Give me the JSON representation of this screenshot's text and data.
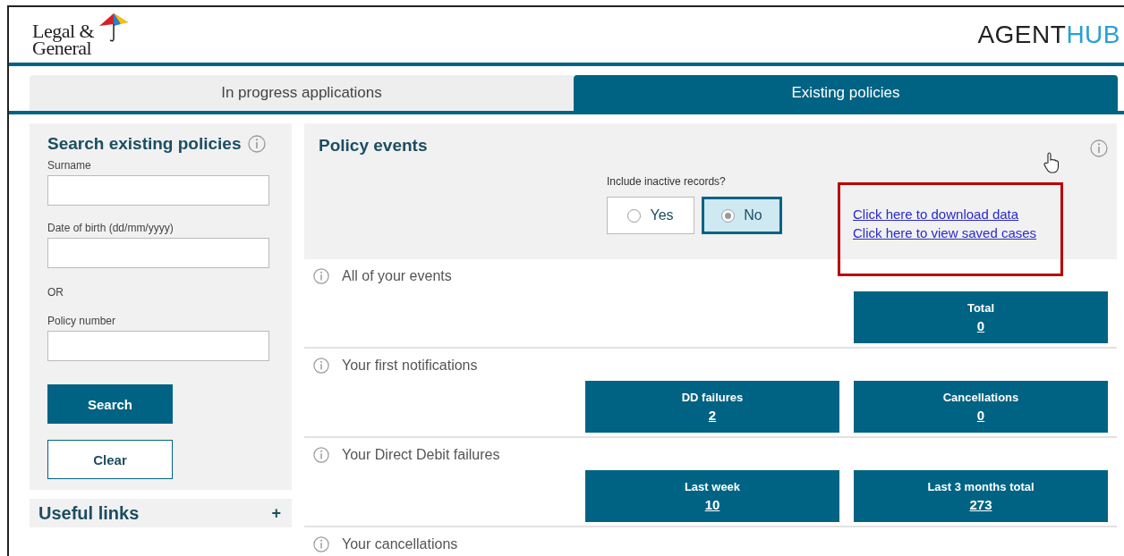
{
  "header": {
    "logo_lines": [
      "Legal &",
      "General"
    ],
    "product": {
      "part1": "AGENT",
      "part2": "HUB"
    }
  },
  "tabs": [
    {
      "label": "In progress applications",
      "selected": false
    },
    {
      "label": "Existing policies",
      "selected": true
    }
  ],
  "search_panel": {
    "title": "Search existing policies",
    "fields": [
      {
        "label": "Surname"
      },
      {
        "label": "Date of birth (dd/mm/yyyy)"
      }
    ],
    "separator": "OR",
    "fields_2": [
      {
        "label": "Policy number"
      }
    ],
    "buttons": [
      {
        "label": "Search",
        "kind": "primary"
      },
      {
        "label": "Clear",
        "kind": "secondary"
      }
    ]
  },
  "useful_links": {
    "title": "Useful links",
    "expand": "+"
  },
  "policy_events": {
    "title": "Policy events",
    "question": "Include inactive records?",
    "options": [
      {
        "label": "Yes",
        "selected": false
      },
      {
        "label": "No",
        "selected": true
      }
    ],
    "links": [
      "Click here to download data",
      "Click here to view saved cases"
    ]
  },
  "sections": [
    {
      "title": "All of your events",
      "tiles": [
        {
          "label": "Total",
          "value": "0"
        }
      ]
    },
    {
      "title": "Your first notifications",
      "tiles": [
        {
          "label": "DD failures",
          "value": "2"
        },
        {
          "label": "Cancellations",
          "value": "0"
        }
      ]
    },
    {
      "title": "Your Direct Debit failures",
      "tiles": [
        {
          "label": "Last week",
          "value": "10"
        },
        {
          "label": "Last 3 months total",
          "value": "273"
        }
      ]
    },
    {
      "title": "Your cancellations"
    }
  ]
}
